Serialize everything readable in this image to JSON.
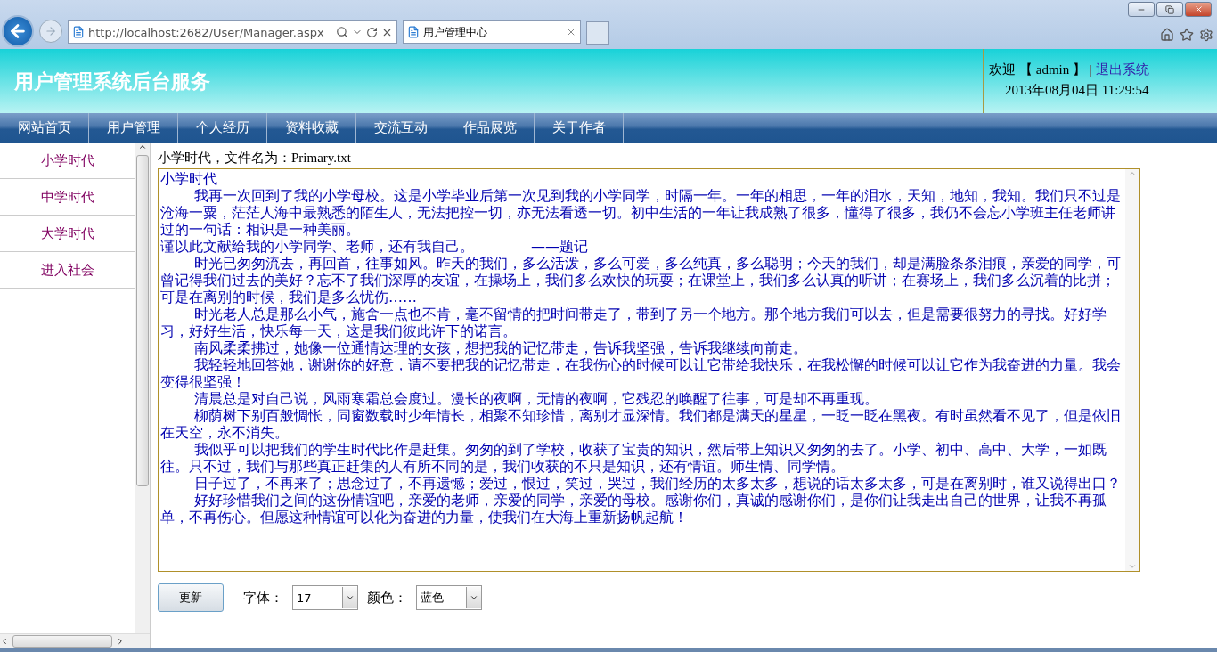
{
  "browser": {
    "url": "http://localhost:2682/User/Manager.aspx",
    "tab_title": "用户管理中心"
  },
  "header": {
    "title": "用户管理系统后台服务",
    "welcome": "欢迎",
    "user": "【 admin 】",
    "separator": "|",
    "logout": "退出系统",
    "datetime": "2013年08月04日 11:29:54"
  },
  "nav": [
    "网站首页",
    "用户管理",
    "个人经历",
    "资料收藏",
    "交流互动",
    "作品展览",
    "关于作者"
  ],
  "sidebar": {
    "items": [
      "小学时代",
      "中学时代",
      "大学时代",
      "进入社会"
    ]
  },
  "content": {
    "file_label": "小学时代，文件名为：Primary.txt",
    "paragraphs": [
      {
        "text": "小学时代",
        "indent": false
      },
      {
        "text": "我再一次回到了我的小学母校。这是小学毕业后第一次见到我的小学同学，时隔一年。一年的相思，一年的泪水，天知，地知，我知。我们只不过是沧海一粟，茫茫人海中最熟悉的陌生人，无法把控一切，亦无法看透一切。初中生活的一年让我成熟了很多，懂得了很多，我仍不会忘小学班主任老师讲过的一句话：相识是一种美丽。",
        "indent": true
      },
      {
        "text": "谨以此文献给我的小学同学、老师，还有我自己。　　　　——题记",
        "indent": false
      },
      {
        "text": "时光已匆匆流去，再回首，往事如风。昨天的我们，多么活泼，多么可爱，多么纯真，多么聪明；今天的我们，却是满脸条条泪痕，亲爱的同学，可曾记得我们过去的美好？忘不了我们深厚的友谊，在操场上，我们多么欢快的玩耍；在课堂上，我们多么认真的听讲；在赛场上，我们多么沉着的比拼；可是在离别的时候，我们是多么忧伤……",
        "indent": true
      },
      {
        "text": "时光老人总是那么小气，施舍一点也不肯，毫不留情的把时间带走了，带到了另一个地方。那个地方我们可以去，但是需要很努力的寻找。好好学习，好好生活，快乐每一天，这是我们彼此许下的诺言。",
        "indent": true
      },
      {
        "text": "南风柔柔拂过，她像一位通情达理的女孩，想把我的记忆带走，告诉我坚强，告诉我继续向前走。",
        "indent": true
      },
      {
        "text": "我轻轻地回答她，谢谢你的好意，请不要把我的记忆带走，在我伤心的时候可以让它带给我快乐，在我松懈的时候可以让它作为我奋进的力量。我会变得很坚强！",
        "indent": true
      },
      {
        "text": "清晨总是对自己说，风雨寒霜总会度过。漫长的夜啊，无情的夜啊，它残忍的唤醒了往事，可是却不再重现。",
        "indent": true
      },
      {
        "text": "柳荫树下别百般惆怅，同窗数载时少年情长，相聚不知珍惜，离别才显深情。我们都是满天的星星，一眨一眨在黑夜。有时虽然看不见了，但是依旧在天空，永不消失。",
        "indent": true
      },
      {
        "text": "我似乎可以把我们的学生时代比作是赶集。匆匆的到了学校，收获了宝贵的知识，然后带上知识又匆匆的去了。小学、初中、高中、大学，一如既往。只不过，我们与那些真正赶集的人有所不同的是，我们收获的不只是知识，还有情谊。师生情、同学情。",
        "indent": true
      },
      {
        "text": "日子过了，不再来了；思念过了，不再遗憾；爱过，恨过，笑过，哭过，我们经历的太多太多，想说的话太多太多，可是在离别时，谁又说得出口？",
        "indent": true
      },
      {
        "text": "好好珍惜我们之间的这份情谊吧，亲爱的老师，亲爱的同学，亲爱的母校。感谢你们，真诚的感谢你们，是你们让我走出自己的世界，让我不再孤单，不再伤心。但愿这种情谊可以化为奋进的力量，使我们在大海上重新扬帆起航！",
        "indent": true
      }
    ]
  },
  "controls": {
    "update_button": "更新",
    "font_label": "字体：",
    "font_value": "17",
    "color_label": "颜色：",
    "color_value": "蓝色"
  }
}
